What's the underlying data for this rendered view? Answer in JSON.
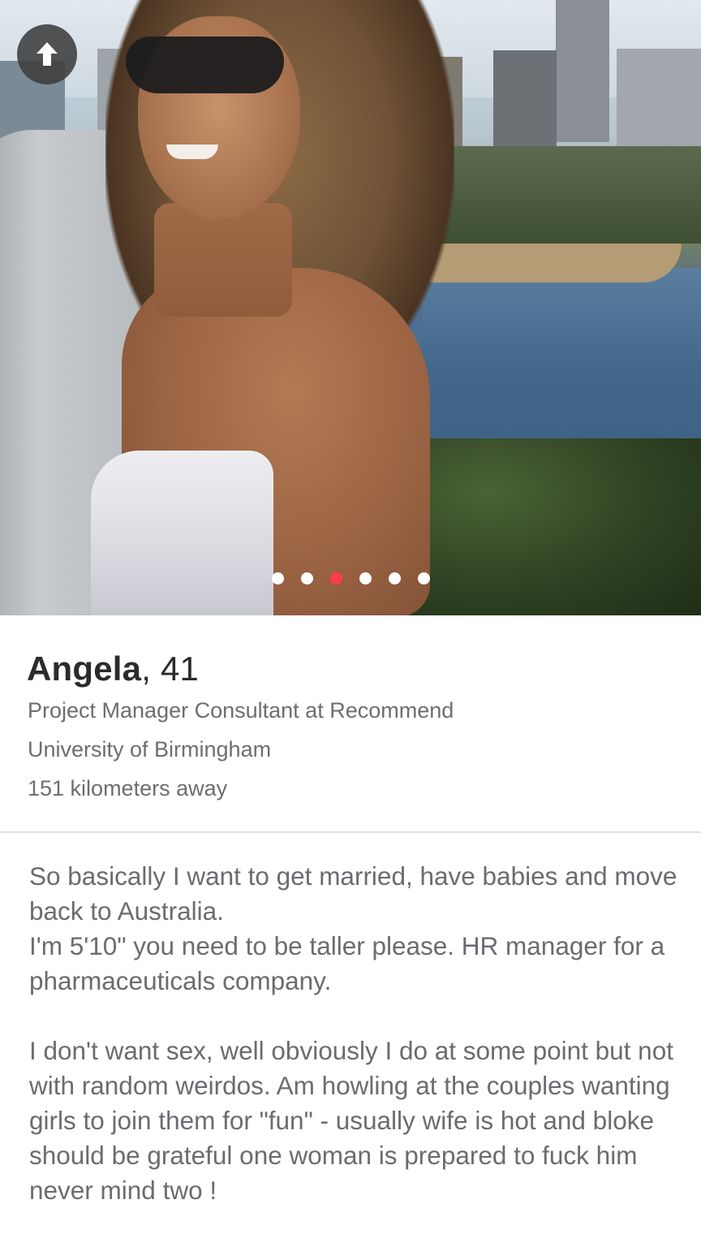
{
  "photo": {
    "pages_total": 6,
    "active_page": 3,
    "description_icon": "up-arrow-icon"
  },
  "profile": {
    "name": "Angela",
    "age_separator": ",",
    "age": "41",
    "job": "Project Manager Consultant at Recommend",
    "school": "University of Birmingham",
    "distance": "151 kilometers away"
  },
  "bio": {
    "text": "So basically I want to get married, have babies and move back to Australia.\nI'm 5'10\" you need to be taller please.  HR manager for a pharmaceuticals company.\n\nI don't want sex, well obviously I do at some point but not with random weirdos.  Am howling at the couples wanting girls to join them for \"fun\" - usually wife is hot and bloke should be grateful one woman is prepared to fuck him never mind two !"
  },
  "colors": {
    "active_dot": "#fe3c4f",
    "inactive_dot": "#ffffff",
    "name_text": "#2b2b2b",
    "detail_text": "#6d6d72",
    "bio_text": "#6b6b70"
  }
}
